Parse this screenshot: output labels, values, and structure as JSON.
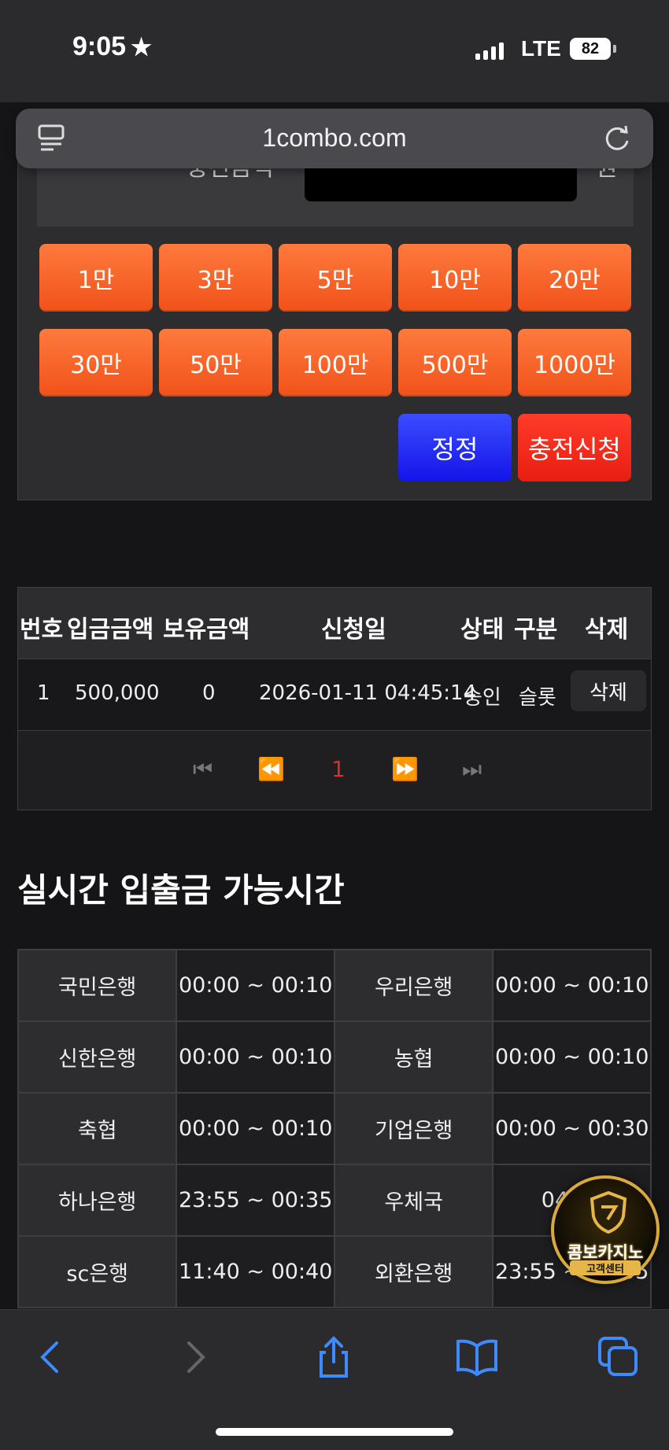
{
  "status_bar": {
    "time": "9:05",
    "network": "LTE",
    "battery": "82"
  },
  "browser": {
    "url": "1combo.com"
  },
  "deposit_form": {
    "label_partial": "충전금액",
    "unit_partial": "원",
    "quick_amounts": [
      "1만",
      "3만",
      "5만",
      "10만",
      "20만",
      "30만",
      "50만",
      "100만",
      "500만",
      "1000만"
    ],
    "edit_label": "정정",
    "apply_label": "충전신청"
  },
  "history": {
    "columns": [
      "번호",
      "입금금액",
      "보유금액",
      "신청일",
      "상태",
      "구분",
      "삭제"
    ],
    "rows": [
      {
        "no": "1",
        "deposit": "500,000",
        "balance": "0",
        "date": "2026-01-11 04:45:14",
        "status": "승인",
        "type": "슬롯",
        "delete": "삭제"
      }
    ],
    "pagination": {
      "current": "1"
    }
  },
  "hours": {
    "title": "실시간 입출금 가능시간",
    "rows": [
      [
        {
          "bank": "국민은행",
          "time": "00:00 ~ 00:10"
        },
        {
          "bank": "우리은행",
          "time": "00:00 ~ 00:10"
        }
      ],
      [
        {
          "bank": "신한은행",
          "time": "00:00 ~ 00:10"
        },
        {
          "bank": "농협",
          "time": "00:00 ~ 00:10"
        }
      ],
      [
        {
          "bank": "축협",
          "time": "00:00 ~ 00:10"
        },
        {
          "bank": "기업은행",
          "time": "00:00 ~ 00:30"
        }
      ],
      [
        {
          "bank": "하나은행",
          "time": "23:55 ~ 00:35"
        },
        {
          "bank": "우체국",
          "time": "04:00"
        }
      ],
      [
        {
          "bank": "sc은행",
          "time": "11:40 ~ 00:40"
        },
        {
          "bank": "외환은행",
          "time": "23:55 ~ 00:05"
        }
      ]
    ]
  },
  "support_badge": {
    "title": "콤보카지노",
    "subtitle": "고객센터"
  },
  "colors": {
    "accent_orange": "#f0521a",
    "edit_blue": "#1414e8",
    "apply_red": "#e81e10",
    "page_bg": "#151417"
  }
}
